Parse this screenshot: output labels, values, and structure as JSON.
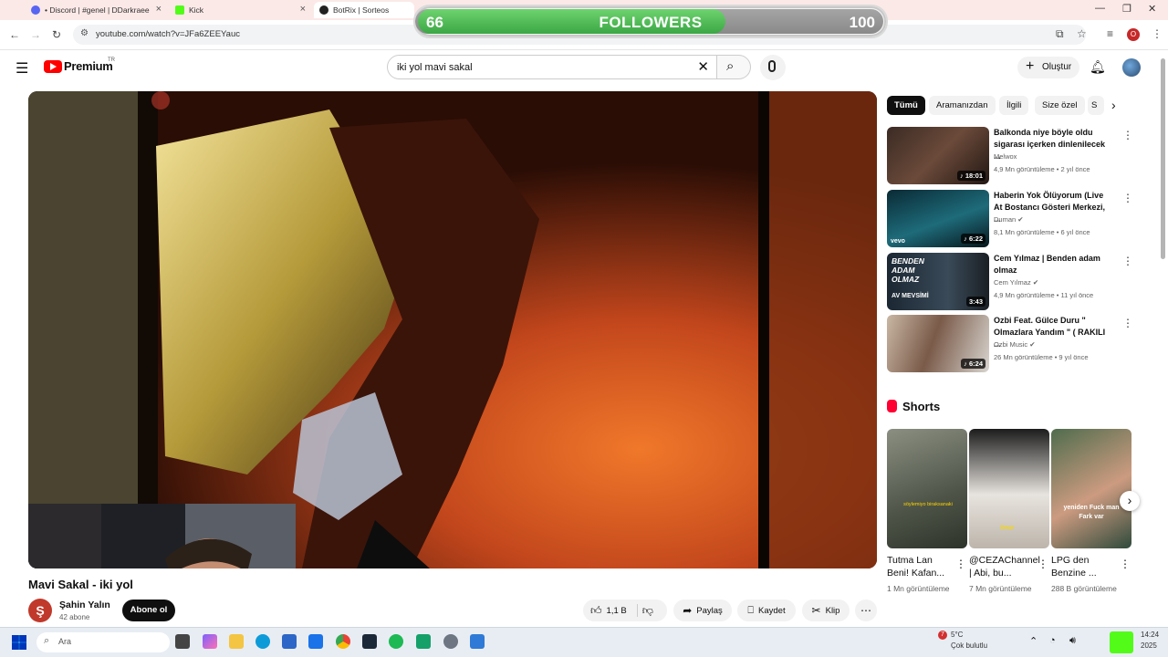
{
  "browser": {
    "tabs": [
      {
        "label": "• Discord | #genel | DDarkraee",
        "favicon_color": "#5865f2"
      },
      {
        "label": "Kick",
        "favicon_color": "#53fc18"
      },
      {
        "label": "BotRix | Sorteos",
        "favicon_color": "#222222"
      }
    ],
    "url": "youtube.com/watch?v=JFa6ZEEYauc",
    "profile_letter": "O"
  },
  "followers_goal": {
    "current": "66",
    "label": "FOLLOWERS",
    "target": "100",
    "progress": 0.66
  },
  "youtube": {
    "brand": "Premium",
    "region": "TR",
    "search_value": "iki yol mavi sakal",
    "create_label": "Oluştur",
    "video": {
      "title": "Mavi Sakal - iki yol",
      "channel_initial": "Ş",
      "channel": "Şahin Yalın",
      "subscribers": "42 abone",
      "subscribe_label": "Abone ol",
      "likes": "1,1 B",
      "share_label": "Paylaş",
      "save_label": "Kaydet",
      "clip_label": "Klip"
    },
    "chips": [
      "Tümü",
      "Aramanızdan",
      "İlgili",
      "Size özel",
      "S"
    ],
    "related": [
      {
        "title": "Balkonda niye böyle oldu sigarası içerken dinlenilecek ...",
        "channel": "Melwox",
        "meta": "4,9 Mn görüntüleme • 2 yıl önce",
        "duration": "18:01"
      },
      {
        "title": "Haberin Yok Ölüyorum (Live At Bostancı Gösteri Merkezi, ...",
        "channel": "Duman",
        "meta": "8,1 Mn görüntüleme • 6 yıl önce",
        "duration": "6:22",
        "thumb_tag": "vevo"
      },
      {
        "title": "Cem Yılmaz | Benden adam olmaz",
        "channel": "Cem Yılmaz",
        "meta": "4,9 Mn görüntüleme • 11 yıl önce",
        "duration": "3:43",
        "thumb_text": "BENDEN ADAM OLMAZ",
        "thumb_sub": "AV MEVSİMİ"
      },
      {
        "title": "Ozbi Feat. Gülce Duru \" Olmazlara Yandım \" ( RAKILI ...",
        "channel": "Ozbi Music",
        "meta": "26 Mn görüntüleme • 9 yıl önce",
        "duration": "6:24"
      }
    ],
    "shorts_title": "Shorts",
    "shorts": [
      {
        "title": "Tutma Lan Beni! Kafan...",
        "views": "1 Mn görüntüleme",
        "caption": "söylemiyo biraksanaki"
      },
      {
        "title": "@CEZAChannel | Abi, bu...",
        "views": "7 Mn görüntüleme",
        "caption": "Umar"
      },
      {
        "title": "LPG den Benzine ...",
        "views": "288 B görüntüleme",
        "caption": "yeniden Fuck man Fark var"
      }
    ]
  },
  "taskbar": {
    "search_placeholder": "Ara",
    "weather_temp": "5°C",
    "weather_text": "Çok bulutlu",
    "weather_badge": "7",
    "time": "14:24",
    "date": "2025"
  }
}
